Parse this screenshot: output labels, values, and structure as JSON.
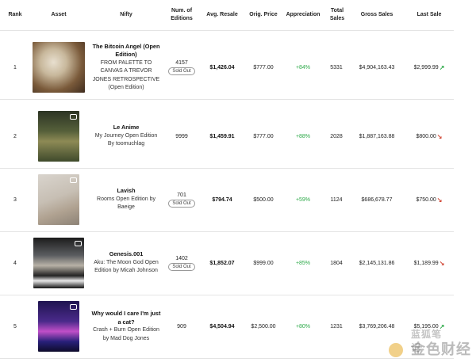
{
  "headers": {
    "rank": "Rank",
    "asset": "Asset",
    "nifty": "Nifty",
    "editions": "Num. of Editions",
    "avg": "Avg. Resale",
    "orig": "Orig. Price",
    "appr": "Appreciation",
    "total": "Total Sales",
    "gross": "Gross Sales",
    "last": "Last Sale"
  },
  "rows": [
    {
      "rank": "1",
      "title": "The Bitcoin Angel (Open Edition)",
      "subtitle": "FROM PALETTE TO CANVAS A TREVOR JONES RETROSPECTIVE (Open Edition)",
      "editions": "4157",
      "badge": "Sold Out",
      "avg": "$1,426.04",
      "orig": "$777.00",
      "appr": "+84%",
      "total": "5331",
      "gross": "$4,904,163.43",
      "last": "$2,999.99",
      "trend": "up"
    },
    {
      "rank": "2",
      "title": "Le Anime",
      "subtitle": "My Journey Open Edition By toomuchlag",
      "editions": "9999",
      "badge": "",
      "avg": "$1,459.91",
      "orig": "$777.00",
      "appr": "+88%",
      "total": "2028",
      "gross": "$1,887,163.88",
      "last": "$800.00",
      "trend": "down"
    },
    {
      "rank": "3",
      "title": "Lavish",
      "subtitle": "Rooms Open Edition by Baeige",
      "editions": "701",
      "badge": "Sold Out",
      "avg": "$794.74",
      "orig": "$500.00",
      "appr": "+59%",
      "total": "1124",
      "gross": "$686,678.77",
      "last": "$750.00",
      "trend": "down"
    },
    {
      "rank": "4",
      "title": "Genesis.001",
      "subtitle": "Aku: The Moon God Open Edition by Micah Johnson",
      "editions": "1402",
      "badge": "Sold Out",
      "avg": "$1,852.07",
      "orig": "$999.00",
      "appr": "+85%",
      "total": "1804",
      "gross": "$2,145,131.86",
      "last": "$1,189.99",
      "trend": "down"
    },
    {
      "rank": "5",
      "title": "Why would I care I'm just a cat?",
      "subtitle": "Crash + Burn Open Edition by Mad Dog Jones",
      "editions": "909",
      "badge": "",
      "avg": "$4,504.94",
      "orig": "$2,500.00",
      "appr": "+80%",
      "total": "1231",
      "gross": "$3,769,206.48",
      "last": "$5,195.00",
      "trend": "up"
    }
  ],
  "icons": {
    "up": "trend-up-icon",
    "down": "trend-down-icon",
    "video": "video-camera-icon"
  },
  "colors": {
    "positive": "#2eaa4a",
    "negative": "#d24b3a"
  },
  "watermark": {
    "text": "金色财经",
    "small": "蓝狐笔记"
  }
}
